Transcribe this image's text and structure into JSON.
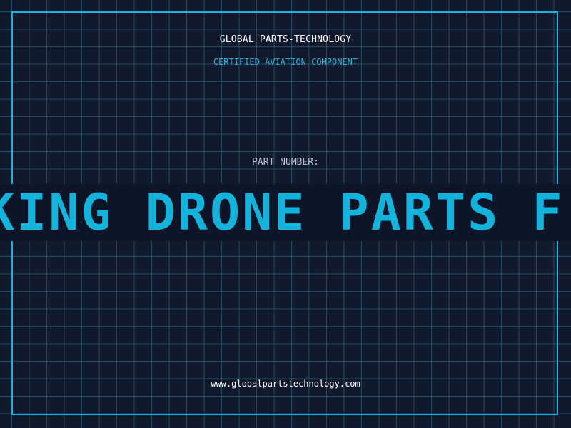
{
  "brand": {
    "name": "GLOBAL PARTS-TECHNOLOGY",
    "subtitle": "CERTIFIED AVIATION COMPONENT"
  },
  "part": {
    "label": "PART NUMBER:",
    "value": "KING DRONE PARTS F"
  },
  "footer": {
    "url": "www.globalpartstechnology.com"
  },
  "colors": {
    "background": "#111a2d",
    "grid": "#38849f",
    "accent": "#12b6dc",
    "text": "#ffffff"
  }
}
